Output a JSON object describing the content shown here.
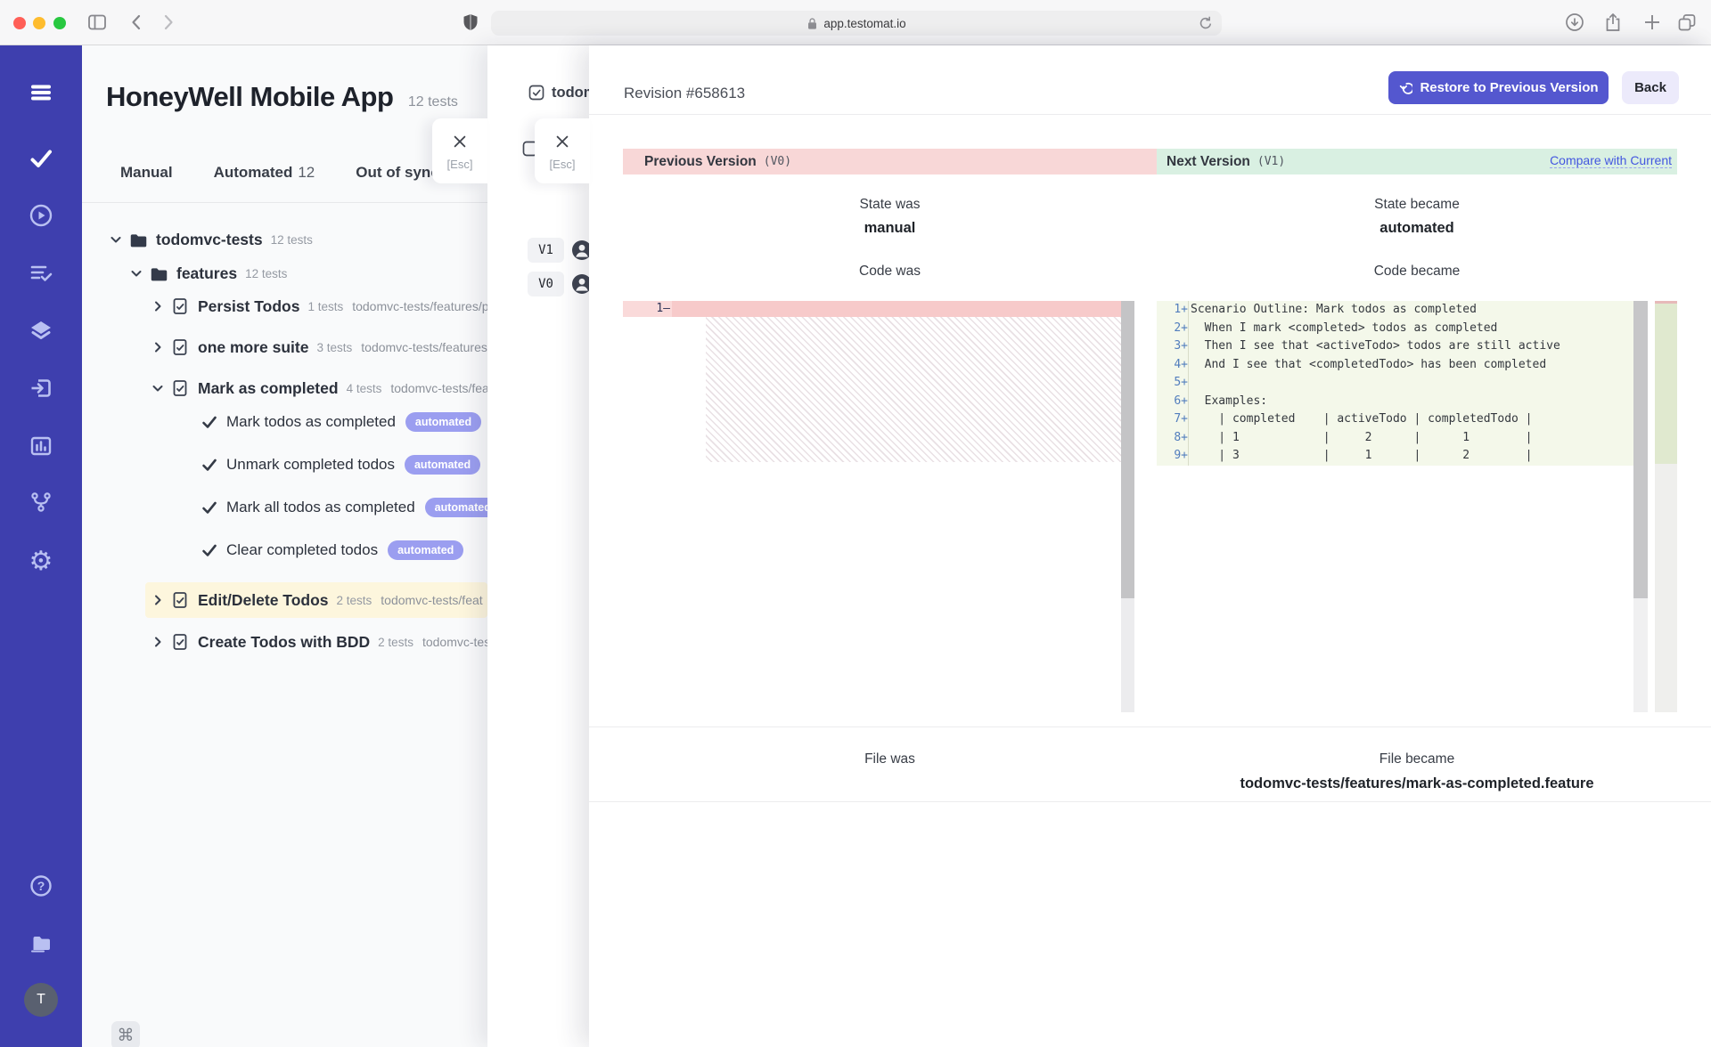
{
  "browser": {
    "url": "app.testomat.io"
  },
  "sidebar": {
    "icons": [
      "menu-icon",
      "tests-check-icon",
      "run-play-icon",
      "test-plans-icon",
      "layers-icon",
      "import-icon",
      "analytics-icon",
      "branch-icon",
      "settings-gear-icon",
      "help-icon",
      "projects-folder-icon"
    ],
    "avatar_initial": "T"
  },
  "project": {
    "title": "HoneyWell Mobile App",
    "tests_count": "12 tests"
  },
  "tabs": {
    "manual": "Manual",
    "automated": "Automated",
    "automated_count": "12",
    "out_of_sync": "Out of sync"
  },
  "tree": {
    "items": [
      {
        "name": "todomvc-tests",
        "count": "12 tests"
      },
      {
        "name": "features",
        "count": "12 tests"
      },
      {
        "name": "Persist Todos",
        "count": "1 tests",
        "path": "todomvc-tests/features/p"
      },
      {
        "name": "one more suite",
        "count": "3 tests",
        "path": "todomvc-tests/features"
      },
      {
        "name": "Mark as completed",
        "count": "4 tests",
        "path": "todomvc-tests/fea"
      },
      {
        "name": "Mark todos as completed",
        "badge": "automated"
      },
      {
        "name": "Unmark completed todos",
        "badge": "automated"
      },
      {
        "name": "Mark all todos as completed",
        "badge": "automated"
      },
      {
        "name": "Clear completed todos",
        "badge": "automated"
      },
      {
        "name": "Edit/Delete Todos",
        "count": "2 tests",
        "path": "todomvc-tests/feat"
      },
      {
        "name": "Create Todos with BDD",
        "count": "2 tests",
        "path": "todomvc-test"
      }
    ]
  },
  "shortcut_hint": "⌘",
  "suite_panel": {
    "title": "todom",
    "esc_label": "[Esc]",
    "versions": [
      {
        "label": "V1"
      },
      {
        "label": "V0"
      }
    ]
  },
  "revision": {
    "title": "Revision #658613",
    "restore_button": "Restore to Previous Version",
    "back_button": "Back",
    "esc_label": "[Esc]",
    "previous": {
      "header": "Previous Version",
      "version": "(V0)",
      "state_label": "State was",
      "state": "manual",
      "code_label": "Code was",
      "file_label": "File was",
      "diff_line_gutter": "1—"
    },
    "next": {
      "header": "Next Version",
      "version": "(V1)",
      "compare_link": "Compare with Current",
      "state_label": "State became",
      "state": "automated",
      "code_label": "Code became",
      "file_label": "File became",
      "file": "todomvc-tests/features/mark-as-completed.feature",
      "diff_lines": [
        {
          "gutter": "1+",
          "text": "Scenario Outline: Mark todos as completed"
        },
        {
          "gutter": "2+",
          "text": "  When I mark <completed> todos as completed"
        },
        {
          "gutter": "3+",
          "text": "  Then I see that <activeTodo> todos are still active"
        },
        {
          "gutter": "4+",
          "text": "  And I see that <completedTodo> has been completed"
        },
        {
          "gutter": "5+",
          "text": ""
        },
        {
          "gutter": "6+",
          "text": "  Examples:"
        },
        {
          "gutter": "7+",
          "text": "    | completed    | activeTodo | completedTodo |"
        },
        {
          "gutter": "8+",
          "text": "    | 1            |     2      |      1        |"
        },
        {
          "gutter": "9+",
          "text": "    | 3            |     1      |      2        |"
        }
      ]
    }
  },
  "colors": {
    "sidebar": "#3e3fae",
    "accent": "#5457cf",
    "badge": "#9b9ef0",
    "diff_removed_header": "#f8d7d7",
    "diff_added_header": "#d9f0e2",
    "diff_added_bg": "#f4f8ea",
    "diff_removed_row": "#f7caca",
    "link": "#4356e0",
    "highlight_row": "#fdf6dd"
  }
}
